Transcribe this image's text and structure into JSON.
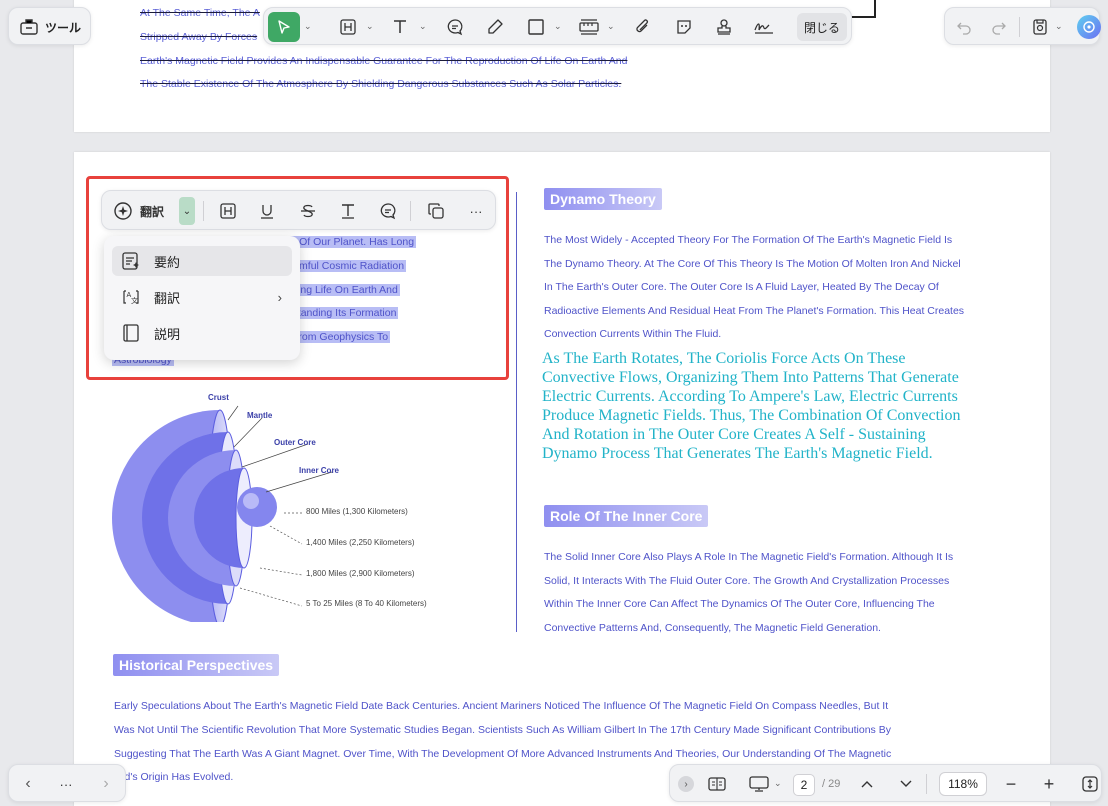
{
  "top_toolbar": {
    "tools_label": "ツール",
    "close_label": "閉じる"
  },
  "page1_lines": [
    "At The Same Time, The A",
    "Stripped Away By Forces",
    "Earth's Magnetic Field Provides An Indispensable Guarantee For The Reproduction Of Life On Earth And",
    "The Stable Existence Of The Atmosphere By Shielding Dangerous Substances Such As Solar Particles."
  ],
  "selection_toolbar": {
    "translate_label": "翻訳"
  },
  "menu": {
    "items": [
      {
        "label": "要約",
        "icon": "summary-icon"
      },
      {
        "label": "翻訳",
        "icon": "translate-icon"
      },
      {
        "label": "説明",
        "icon": "book-icon"
      }
    ]
  },
  "left_selected_lines": [
    "Feature Of Our Planet. Has Long",
    "d Against Harmful Cosmic Radiation",
    "le In Protecting Life On Earth And",
    "sphere. Understanding Its Formation",
    "Disciplines, From Geophysics To",
    "Astrobiology"
  ],
  "diagram": {
    "labels": [
      "Crust",
      "Mantle",
      "Outer Core",
      "Inner Core"
    ],
    "measurements": [
      "800 Miles (1,300 Kilometers)",
      "1,400 Miles (2,250 Kilometers)",
      "1,800 Miles (2,900 Kilometers)",
      "5 To 25 Miles (8 To 40 Kilometers)"
    ]
  },
  "dynamo": {
    "heading": "Dynamo Theory",
    "lines": [
      "The Most Widely - Accepted Theory For The Formation Of The Earth's Magnetic Field Is",
      "The Dynamo Theory. At The Core Of This Theory Is The Motion Of Molten Iron And Nickel",
      "In The Earth's Outer Core. The Outer Core Is A Fluid Layer, Heated By The Decay Of",
      "Radioactive Elements And Residual Heat From The Planet's Formation. This Heat Creates",
      "Convection Currents Within The Fluid."
    ],
    "serif_lines": [
      "As The Earth Rotates, The Coriolis Force Acts On These",
      "Convective Flows, Organizing Them Into Patterns That Generate",
      "Electric Currents. According To Ampere's Law, Electric Currents",
      "Produce Magnetic Fields. Thus, The Combination Of Convection",
      "And Rotation in The Outer Core Creates A Self - Sustaining",
      "Dynamo Process That Generates The Earth's Magnetic Field."
    ]
  },
  "inner_core": {
    "heading": "Role Of The Inner Core",
    "lines": [
      "The Solid Inner Core Also Plays A Role In The Magnetic Field's Formation. Although It Is",
      "Solid, It Interacts With The Fluid Outer Core. The Growth And Crystallization Processes",
      "Within The Inner Core Can Affect The Dynamics Of The Outer Core, Influencing The",
      "Convective Patterns And, Consequently, The Magnetic Field Generation."
    ]
  },
  "historical": {
    "heading": "Historical Perspectives",
    "lines": [
      "Early Speculations About The Earth's Magnetic Field Date Back Centuries. Ancient Mariners Noticed The Influence Of The Magnetic Field On Compass Needles, But It",
      "Was Not Until The Scientific Revolution That More Systematic Studies Began. Scientists Such As William Gilbert In The 17th Century Made Significant Contributions By",
      "Suggesting That The Earth Was A Giant Magnet. Over Time, With The Development Of More Advanced Instruments And Theories, Our Understanding Of The Magnetic",
      "ield's Origin Has Evolved."
    ]
  },
  "bottom_bar": {
    "more_label": "···",
    "current_page": "2",
    "total_pages": "/ 29",
    "zoom": "118%"
  },
  "colors": {
    "accent_green": "#3fa865",
    "highlight_border": "#e8413c",
    "text_blue": "#4f53c9",
    "serif_teal": "#21b3c8"
  }
}
